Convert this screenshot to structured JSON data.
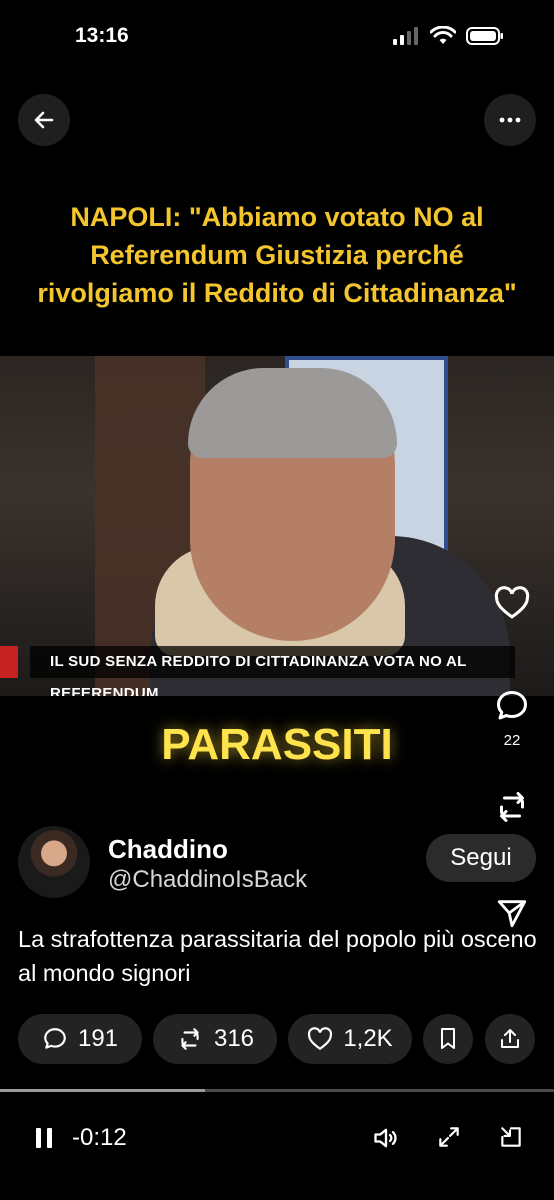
{
  "status_bar": {
    "time": "13:16"
  },
  "icons": {
    "back": "arrow-left-icon",
    "more": "more-horizontal-icon",
    "like": "heart-icon",
    "reply": "comment-icon",
    "repost": "repost-icon",
    "share": "share-icon",
    "bookmark": "bookmark-icon",
    "pause": "pause-icon",
    "volume": "volume-icon",
    "fullscreen": "expand-icon",
    "pip": "pip-icon"
  },
  "video": {
    "caption_top": [
      "NAPOLI: \"Abbiamo votato NO al",
      "Referendum Giustizia perché",
      "rivolgiamo il Reddito di Cittadinanza\""
    ],
    "lower_third": "IL SUD SENZA REDDITO DI CITTADINANZA VOTA NO AL REFERENDUM",
    "caption_bottom": "PARASSITI",
    "progress": 0.37,
    "time_remaining": "-0:12"
  },
  "side_actions": {
    "reply_count": "22"
  },
  "author": {
    "name": "Chaddino",
    "handle": "@ChaddinoIsBack",
    "follow_label": "Segui"
  },
  "tweet": {
    "text": "La strafottenza parassitaria del popolo più osceno al mondo signori"
  },
  "actions": {
    "replies": "191",
    "reposts": "316",
    "likes": "1,2K"
  },
  "colors": {
    "caption_top": "#f4c52c",
    "caption_bottom": "#ffe34d",
    "pill_bg": "#232323"
  }
}
